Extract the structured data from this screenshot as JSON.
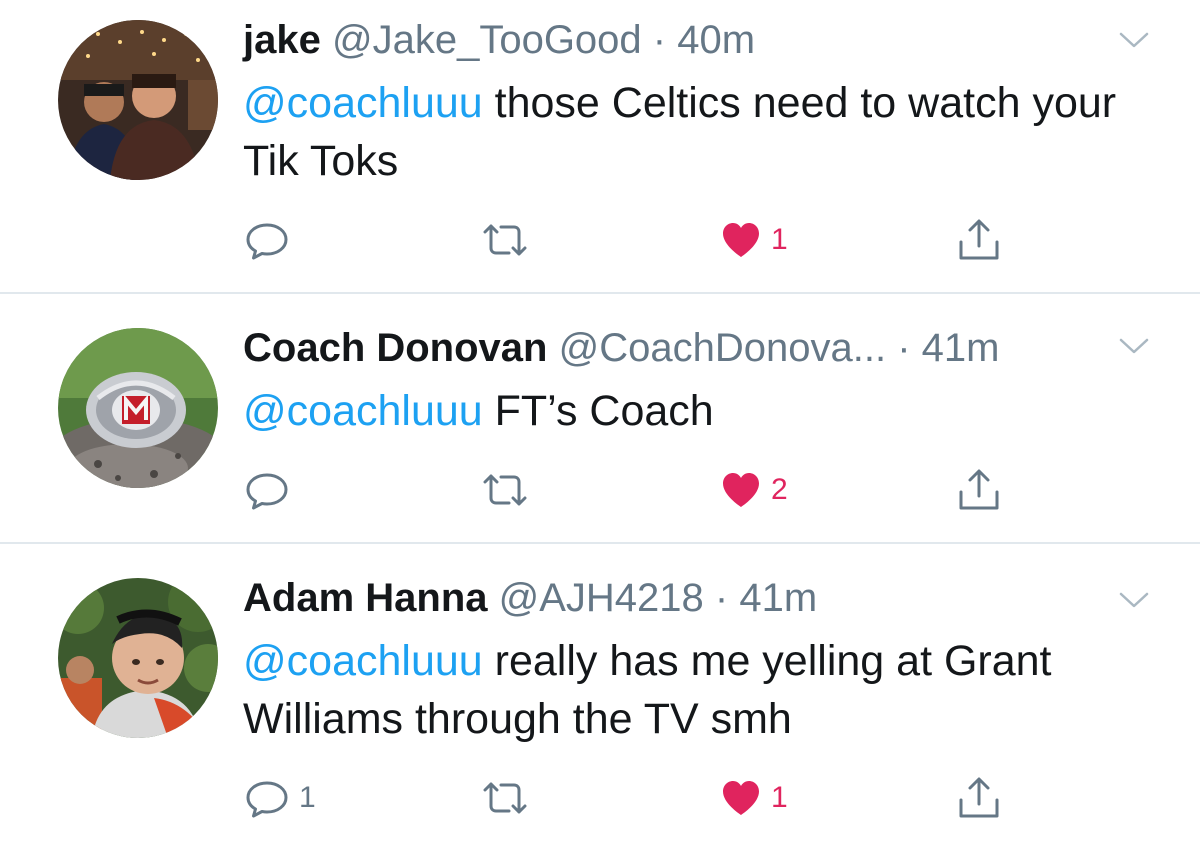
{
  "colors": {
    "link": "#1da1f2",
    "secondary_text": "#657786",
    "like_red": "#e0245e",
    "divider": "#e1e8ed"
  },
  "icons": {
    "reply": "speech-bubble-icon",
    "retweet": "retweet-arrows-icon",
    "like": "heart-icon",
    "share": "share-upload-icon",
    "menu": "chevron-down-icon"
  },
  "tweets": [
    {
      "name": "jake",
      "handle": "@Jake_TooGood",
      "dot": "·",
      "time": "40m",
      "mention": "@coachluuu",
      "text": " those Celtics need to watch your Tik Toks",
      "reply_count": "",
      "retweet_count": "",
      "like_count": "1",
      "liked": true
    },
    {
      "name": "Coach Donovan",
      "handle": "@CoachDonova...",
      "dot": "·",
      "time": "41m",
      "mention": "@coachluuu",
      "text": " FT’s Coach",
      "reply_count": "",
      "retweet_count": "",
      "like_count": "2",
      "liked": true
    },
    {
      "name": "Adam Hanna",
      "handle": "@AJH4218",
      "dot": "·",
      "time": "41m",
      "mention": "@coachluuu",
      "text": " really has me yelling at Grant Williams through the TV smh",
      "reply_count": "1",
      "retweet_count": "",
      "like_count": "1",
      "liked": true
    }
  ]
}
